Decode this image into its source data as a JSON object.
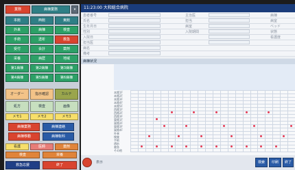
{
  "app": {
    "title": "11:23:00 大和総合病院",
    "section_title": "病棟状況"
  },
  "sidebar": {
    "top_tabs": [
      {
        "label": "業務"
      },
      {
        "label": "病棟業務"
      },
      {
        "label": "▾"
      }
    ],
    "grid_buttons": [
      {
        "label": "本館",
        "color": "#2f7f86"
      },
      {
        "label": "西館",
        "color": "#2f7f86"
      },
      {
        "label": "東館",
        "color": "#2f7f86"
      },
      {
        "label": "外来",
        "color": "#2ca067"
      },
      {
        "label": "病棟",
        "color": "#2ca067"
      },
      {
        "label": "検査",
        "color": "#2ca067"
      },
      {
        "label": "手術",
        "color": "#2ca067"
      },
      {
        "label": "透析",
        "color": "#2ca067"
      },
      {
        "label": "救急",
        "color": "#d9442f"
      },
      {
        "label": "受付",
        "color": "#2ca067"
      },
      {
        "label": "会計",
        "color": "#2ca067"
      },
      {
        "label": "薬剤",
        "color": "#2ca067"
      },
      {
        "label": "栄養",
        "color": "#2ca067"
      },
      {
        "label": "病歴",
        "color": "#2ca067"
      },
      {
        "label": "地域",
        "color": "#2ca067"
      },
      {
        "label": "第1病棟",
        "color": "#2ca067"
      },
      {
        "label": "第2病棟",
        "color": "#2ca067"
      },
      {
        "label": "第3病棟",
        "color": "#2ca067"
      },
      {
        "label": "第4病棟",
        "color": "#2ca067"
      },
      {
        "label": "第5病棟",
        "color": "#2ca067"
      },
      {
        "label": "第6病棟",
        "color": "#2ca067"
      }
    ],
    "quick_buttons": [
      {
        "label": "オーダー",
        "color": "#f3c388"
      },
      {
        "label": "指示確認",
        "color": "#f3c388"
      },
      {
        "label": "カルテ",
        "color": "#9aa54c"
      },
      {
        "label": "処方",
        "color": "#c7dfbf"
      },
      {
        "label": "検査",
        "color": "#c7dfbf"
      },
      {
        "label": "画像",
        "color": "#c7dfbf"
      },
      {
        "label": "メモ1",
        "color": "#f7df6a"
      },
      {
        "label": "メモ2",
        "color": "#f7df6a"
      },
      {
        "label": "メモ3",
        "color": "#f7df6a"
      }
    ],
    "action_buttons": [
      {
        "label": "病棟業務",
        "color": "#d9442f"
      },
      {
        "label": "病棟連絡",
        "color": "#2a5ba6"
      },
      {
        "label": "病棟移動",
        "color": "#d9442f"
      },
      {
        "label": "病棟転科",
        "color": "#2a5ba6"
      },
      {
        "label": "看護",
        "color": "#f7df6a"
      },
      {
        "label": "医師",
        "color": "#e77d78"
      },
      {
        "label": "薬剤",
        "color": "#e0843a"
      },
      {
        "label": "検査",
        "color": "#e0843a"
      },
      {
        "label": "栄養",
        "color": "#e0843a"
      },
      {
        "label": "救急応援",
        "color": "#1f3f86"
      },
      {
        "label": "終了",
        "color": "#d9442f"
      }
    ]
  },
  "form": {
    "rows": [
      {
        "label": "患者番号"
      },
      {
        "label": "氏名"
      },
      {
        "label": "生年月日"
      },
      {
        "label": "性別"
      },
      {
        "label": "入院日"
      },
      {
        "label": "担当医"
      },
      {
        "label": "病名"
      },
      {
        "label": "備考"
      }
    ],
    "mid_labels": [
      "主治医",
      "担当",
      "病室",
      "入院期間"
    ],
    "right_labels": [
      "病棟",
      "病室",
      "ベッド",
      "状態",
      "看護度"
    ]
  },
  "grid": {
    "header": "病棟状況",
    "row_labels": [
      "本館1F",
      "本館2F",
      "本館3F",
      "本館4F",
      "本館5F",
      "西館1F",
      "西館2F",
      "西館3F",
      "東館1F",
      "東館2F",
      "東館3F",
      "東館4F",
      "外来",
      "検査",
      "手術",
      "透析",
      "救急",
      "その他"
    ]
  },
  "bottom": {
    "left_label": "表示",
    "right_buttons": [
      {
        "label": "検索"
      },
      {
        "label": "印刷"
      },
      {
        "label": "終了"
      }
    ]
  }
}
